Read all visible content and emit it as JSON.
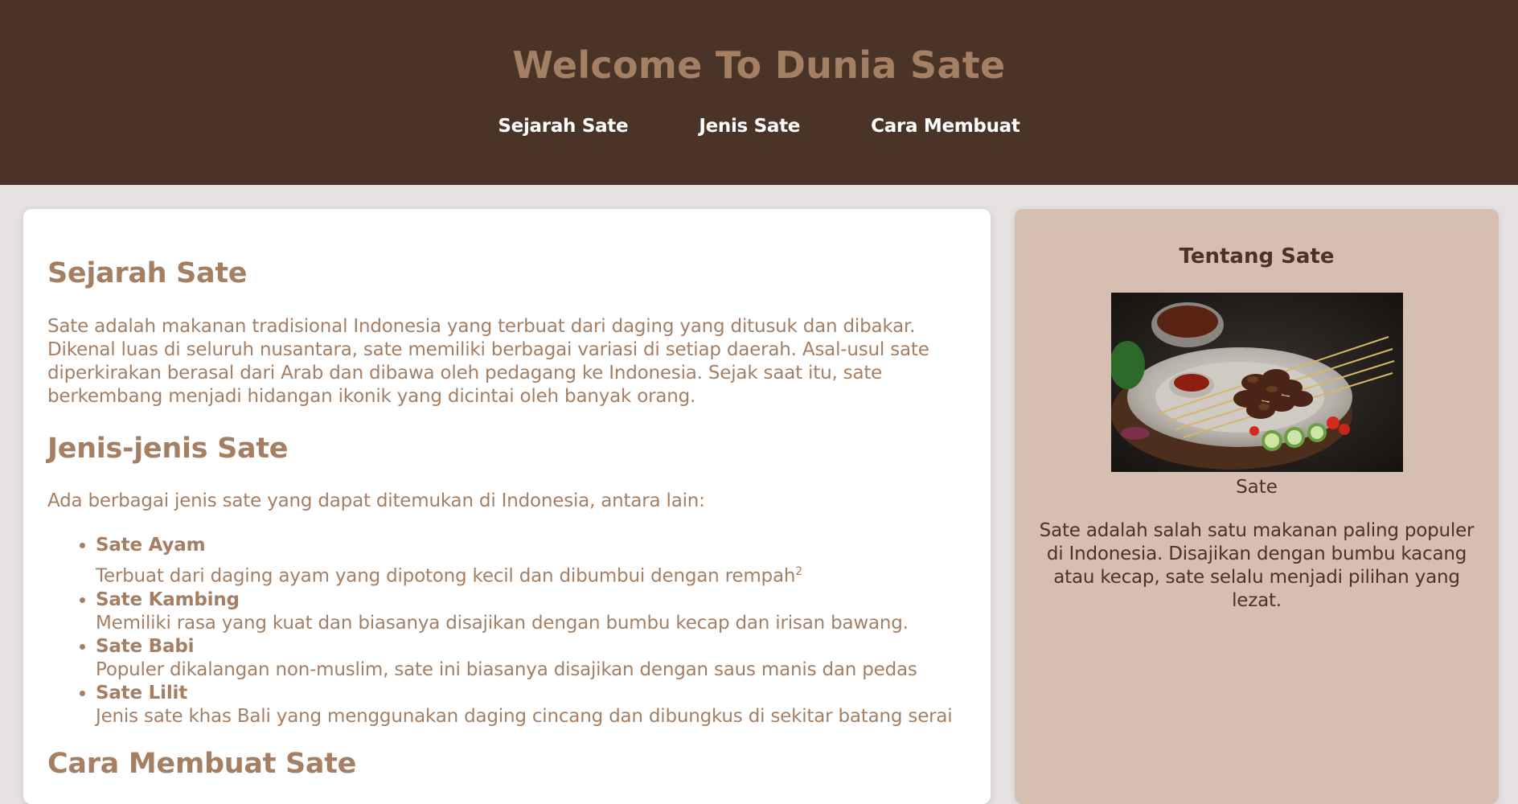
{
  "header": {
    "title": "Welcome To Dunia Sate",
    "nav": [
      "Sejarah Sate",
      "Jenis Sate",
      "Cara Membuat"
    ]
  },
  "main": {
    "sejarah": {
      "heading": "Sejarah Sate",
      "text": "Sate adalah makanan tradisional Indonesia yang terbuat dari daging yang ditusuk dan dibakar. Dikenal luas di seluruh nusantara, sate memiliki berbagai variasi di setiap daerah. Asal-usul sate diperkirakan berasal dari Arab dan dibawa oleh pedagang ke Indonesia. Sejak saat itu, sate berkembang menjadi hidangan ikonik yang dicintai oleh banyak orang."
    },
    "jenis": {
      "heading": "Jenis-jenis Sate",
      "intro": "Ada berbagai jenis sate yang dapat ditemukan di Indonesia, antara lain:",
      "items": [
        {
          "name": "Sate Ayam",
          "desc": "Terbuat dari daging ayam yang dipotong kecil dan dibumbui dengan rempah",
          "sup": "2"
        },
        {
          "name": "Sate Kambing",
          "desc": "Memiliki rasa yang kuat dan biasanya disajikan dengan bumbu kecap dan irisan bawang."
        },
        {
          "name": "Sate Babi",
          "desc": "Populer dikalangan non-muslim, sate ini biasanya disajikan dengan saus manis dan pedas"
        },
        {
          "name": "Sate Lilit",
          "desc": "Jenis sate khas Bali yang menggunakan daging cincang dan dibungkus di sekitar batang serai"
        }
      ]
    },
    "cara": {
      "heading": "Cara Membuat Sate"
    }
  },
  "sidebar": {
    "heading": "Tentang Sate",
    "image_caption": "Sate",
    "description": "Sate adalah salah satu makanan paling populer di Indonesia. Disajikan dengan bumbu kacang atau kecap, sate selalu menjadi pilihan yang lezat."
  },
  "colors": {
    "header_bg": "#4a3428",
    "accent": "#a47f63",
    "sidebar_bg": "#d5bfb1",
    "page_bg": "#e6e2e2"
  }
}
